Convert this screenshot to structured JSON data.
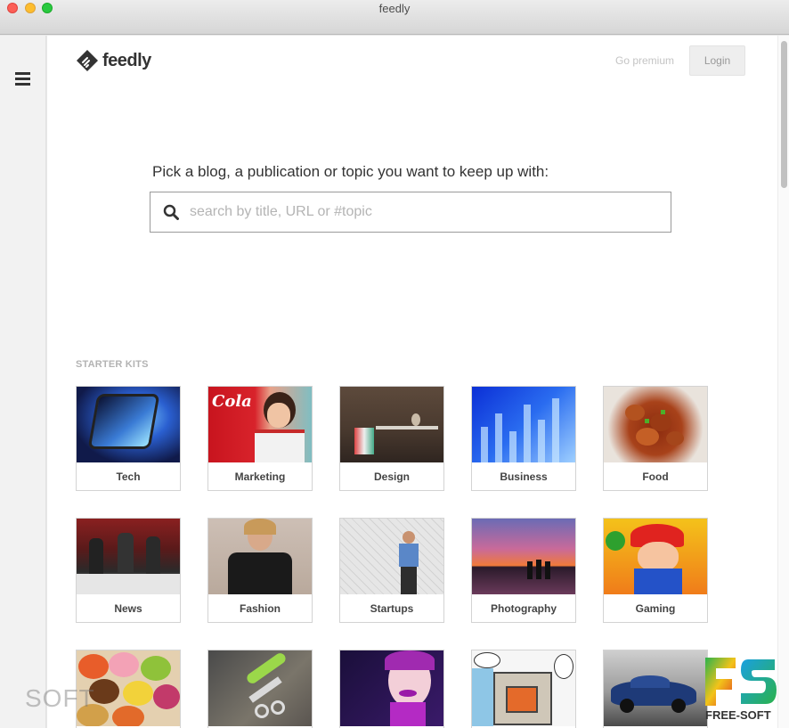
{
  "window": {
    "title": "feedly"
  },
  "header": {
    "logo_text": "feedly",
    "go_premium": "Go premium",
    "login": "Login"
  },
  "search": {
    "prompt": "Pick a blog, a publication or topic you want to keep up with:",
    "placeholder": "search by title, URL or #topic"
  },
  "starter_kits": {
    "label": "STARTER KITS",
    "items": [
      {
        "label": "Tech",
        "image": "tech-photo"
      },
      {
        "label": "Marketing",
        "image": "marketing-photo"
      },
      {
        "label": "Design",
        "image": "design-photo"
      },
      {
        "label": "Business",
        "image": "business-photo"
      },
      {
        "label": "Food",
        "image": "food-photo"
      },
      {
        "label": "News",
        "image": "news-photo"
      },
      {
        "label": "Fashion",
        "image": "fashion-photo"
      },
      {
        "label": "Startups",
        "image": "startups-photo"
      },
      {
        "label": "Photography",
        "image": "photography-photo"
      },
      {
        "label": "Gaming",
        "image": "gaming-photo"
      },
      {
        "label": "",
        "image": "macarons-photo"
      },
      {
        "label": "",
        "image": "tools-photo"
      },
      {
        "label": "",
        "image": "beauty-photo"
      },
      {
        "label": "",
        "image": "comic-photo"
      },
      {
        "label": "",
        "image": "car-photo"
      }
    ]
  },
  "watermarks": {
    "soft": "SOFT",
    "fs": "FREE-SOFT"
  },
  "colors": {
    "accent": "#2bb24c",
    "text": "#333333"
  }
}
